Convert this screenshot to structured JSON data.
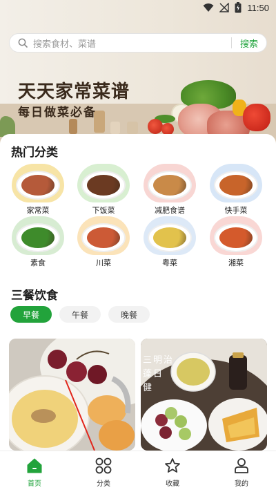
{
  "status_bar": {
    "time": "11:50"
  },
  "search": {
    "placeholder": "搜索食材、菜谱",
    "button": "搜索"
  },
  "banner": {
    "title": "天天家常菜谱",
    "subtitle": "每日做菜必备"
  },
  "hot_categories": {
    "title": "热门分类",
    "items": [
      {
        "label": "家常菜",
        "bg": "#f7e4a6",
        "food": "#b55a3a"
      },
      {
        "label": "下饭菜",
        "bg": "#d8efd1",
        "food": "#6b3a22"
      },
      {
        "label": "减肥食谱",
        "bg": "#f8d6d3",
        "food": "#c98a48"
      },
      {
        "label": "快手菜",
        "bg": "#d7e6f7",
        "food": "#c8642a"
      },
      {
        "label": "素食",
        "bg": "#d7ecd2",
        "food": "#3e8b2b"
      },
      {
        "label": "川菜",
        "bg": "#fbe3b9",
        "food": "#cc5a36"
      },
      {
        "label": "粤菜",
        "bg": "#dde9f7",
        "food": "#e2c24c"
      },
      {
        "label": "湘菜",
        "bg": "#f9d7d4",
        "food": "#d45a2c"
      }
    ]
  },
  "meals": {
    "title": "三餐饮食",
    "tabs": [
      {
        "label": "早餐",
        "active": true
      },
      {
        "label": "午餐",
        "active": false
      },
      {
        "label": "晚餐",
        "active": false
      }
    ],
    "card2_text": "三明治 蓬日 健"
  },
  "nav": {
    "items": [
      {
        "label": "首页",
        "icon": "home-icon",
        "active": true
      },
      {
        "label": "分类",
        "icon": "grid-icon",
        "active": false
      },
      {
        "label": "收藏",
        "icon": "star-icon",
        "active": false
      },
      {
        "label": "我的",
        "icon": "user-icon",
        "active": false
      }
    ]
  },
  "colors": {
    "accent": "#22a33b"
  }
}
